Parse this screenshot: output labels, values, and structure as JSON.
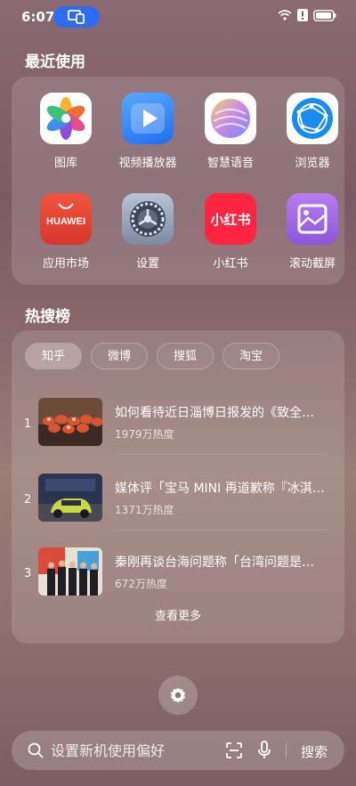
{
  "status_bar": {
    "time": "6:07",
    "icons": [
      "multi-device-icon",
      "wifi-icon",
      "alert-icon",
      "battery-icon"
    ]
  },
  "recent": {
    "title": "最近使用",
    "apps": [
      {
        "label": "图库",
        "icon": "gallery-icon"
      },
      {
        "label": "视频播放器",
        "icon": "video-player-icon"
      },
      {
        "label": "智慧语音",
        "icon": "voice-assistant-icon"
      },
      {
        "label": "浏览器",
        "icon": "browser-icon"
      },
      {
        "label": "应用市场",
        "icon": "app-market-icon",
        "brand": "HUAWEI"
      },
      {
        "label": "设置",
        "icon": "settings-icon"
      },
      {
        "label": "小红书",
        "icon": "xiaohongshu-icon",
        "brand": "小红书"
      },
      {
        "label": "滚动截屏",
        "icon": "scroll-screenshot-icon"
      }
    ]
  },
  "hot": {
    "title": "热搜榜",
    "tabs": [
      "知乎",
      "微博",
      "搜狐",
      "淘宝"
    ],
    "active_tab": "知乎",
    "items": [
      {
        "rank": "1",
        "title": "如何看待近日淄博日报发的《致全市人民的一封信》",
        "heat": "1979万热度"
      },
      {
        "rank": "2",
        "title": "媒体评「宝马 MINI 再道歉称『冰淇淋事件』」",
        "heat": "1371万热度"
      },
      {
        "rank": "3",
        "title": "秦刚再谈台海问题称「台湾问题是中国内政」",
        "heat": "672万热度"
      }
    ],
    "more_label": "查看更多"
  },
  "search": {
    "placeholder": "设置新机使用偏好",
    "button_label": "搜索"
  },
  "colors": {
    "accent_blue": "#2f6bf2",
    "xiaohongshu_red": "#ff2442",
    "huawei_red": "#e8423a"
  }
}
